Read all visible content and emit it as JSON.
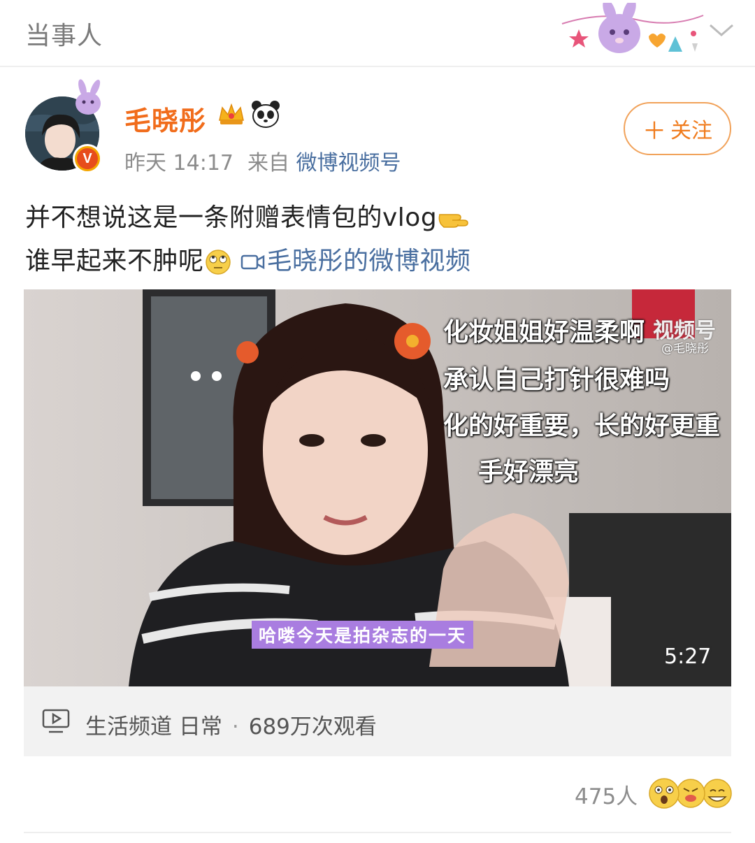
{
  "header": {
    "title": "当事人"
  },
  "author": {
    "name": "毛晓彤",
    "time": "昨天 14:17",
    "from_label": "来自",
    "source": "微博视频号",
    "verified_badge": "V",
    "follow_label": "关注"
  },
  "post": {
    "line1": "并不想说这是一条附赠表情包的vlog",
    "line2": "谁早起来不肿呢",
    "video_link_text": "毛晓彤的微博视频"
  },
  "video": {
    "captions": [
      "化妆姐姐好温柔啊",
      "承认自己打针很难吗",
      "化的好重要，长的好更重",
      "手好漂亮"
    ],
    "watermark_title": "视频号",
    "watermark_handle": "@毛晓彤",
    "subtitle": "哈喽今天是拍杂志的一天",
    "duration": "5:27"
  },
  "video_info": {
    "channel": "生活频道",
    "category": "日常",
    "separator": "·",
    "views": "689万次观看"
  },
  "reactions": {
    "count": "475人"
  },
  "colors": {
    "author_name": "#f16c1b",
    "link": "#4a6fa0",
    "follow_border": "#f1a25a",
    "subtitle_bg": "#a97de0"
  }
}
